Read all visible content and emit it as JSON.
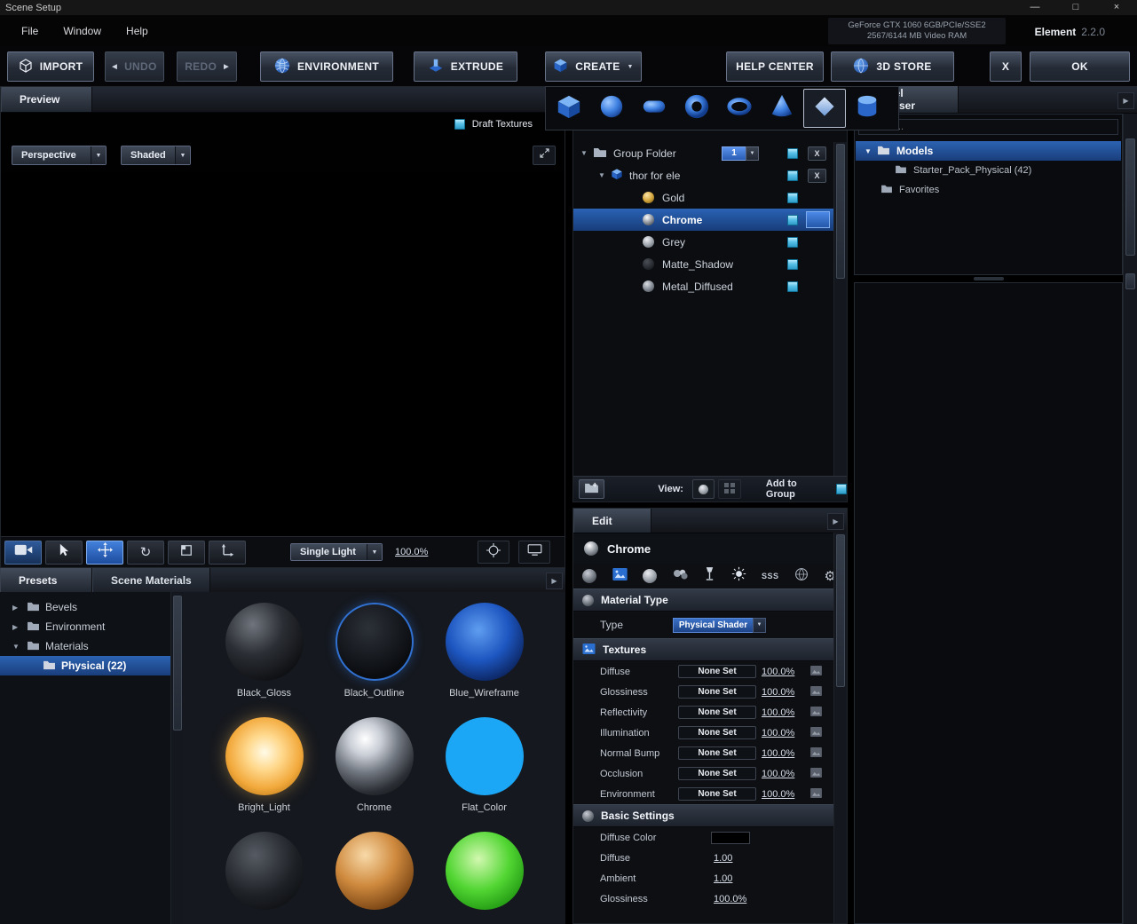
{
  "window": {
    "title": "Scene Setup"
  },
  "menubar": {
    "file": "File",
    "window": "Window",
    "help": "Help",
    "gpu_line1": "GeForce GTX 1060 6GB/PCIe/SSE2",
    "gpu_line2": "2567/6144 MB Video RAM",
    "brand": "Element",
    "version": "2.2.0"
  },
  "toolbar": {
    "import": "IMPORT",
    "undo": "UNDO",
    "redo": "REDO",
    "environment": "ENVIRONMENT",
    "extrude": "EXTRUDE",
    "create": "CREATE",
    "help_center": "HELP CENTER",
    "store": "3D STORE",
    "close": "X",
    "ok": "OK"
  },
  "preview": {
    "tab": "Preview",
    "draft_textures": "Draft Textures",
    "camera_mode": "Perspective",
    "shading_mode": "Shaded",
    "light_mode": "Single Light",
    "zoom": "100.0%"
  },
  "presets": {
    "tab": "Presets",
    "scene_materials_tab": "Scene Materials",
    "items": [
      {
        "label": "Bevels"
      },
      {
        "label": "Environment"
      },
      {
        "label": "Materials"
      },
      {
        "label": "Physical (22)"
      }
    ]
  },
  "materials_grid": {
    "tiles": [
      {
        "label": "Black_Gloss"
      },
      {
        "label": "Black_Outline"
      },
      {
        "label": "Blue_Wireframe"
      },
      {
        "label": "Bright_Light"
      },
      {
        "label": "Chrome"
      },
      {
        "label": "Flat_Color"
      },
      {
        "label": ""
      },
      {
        "label": ""
      },
      {
        "label": ""
      }
    ]
  },
  "scene": {
    "group_label": "Group Folder",
    "group_count": "1",
    "object_label": "thor for ele",
    "close_label": "X",
    "rows": [
      {
        "label": "Gold"
      },
      {
        "label": "Chrome"
      },
      {
        "label": "Grey"
      },
      {
        "label": "Matte_Shadow"
      },
      {
        "label": "Metal_Diffused"
      }
    ],
    "view_label": "View:",
    "add_to_group": "Add to Group"
  },
  "edit": {
    "tab": "Edit",
    "material_name": "Chrome",
    "material_type_header": "Material Type",
    "type_label": "Type",
    "type_value": "Physical Shader",
    "textures_header": "Textures",
    "texture_rows": [
      {
        "label": "Diffuse",
        "button": "None Set",
        "percent": "100.0%"
      },
      {
        "label": "Glossiness",
        "button": "None Set",
        "percent": "100.0%"
      },
      {
        "label": "Reflectivity",
        "button": "None Set",
        "percent": "100.0%"
      },
      {
        "label": "Illumination",
        "button": "None Set",
        "percent": "100.0%"
      },
      {
        "label": "Normal Bump",
        "button": "None Set",
        "percent": "100.0%"
      },
      {
        "label": "Occlusion",
        "button": "None Set",
        "percent": "100.0%"
      },
      {
        "label": "Environment",
        "button": "None Set",
        "percent": "100.0%"
      }
    ],
    "basic_header": "Basic Settings",
    "diffuse_color_label": "Diffuse Color",
    "diffuse_label": "Diffuse",
    "diffuse_value": "1.00",
    "ambient_label": "Ambient",
    "ambient_value": "1.00",
    "glossiness_label": "Glossiness",
    "glossiness_value": "100.0%",
    "sss_icon_label": "SSS"
  },
  "browser": {
    "tab": "Model Browser",
    "search_placeholder": "Search...",
    "items": [
      {
        "label": "Models"
      },
      {
        "label": "Starter_Pack_Physical (42)"
      },
      {
        "label": "Favorites"
      }
    ]
  },
  "colors": {
    "accent_blue": "#2f6fd0",
    "selection_blue": "#2258aa",
    "checkbox_cyan": "#5ec4ea"
  }
}
